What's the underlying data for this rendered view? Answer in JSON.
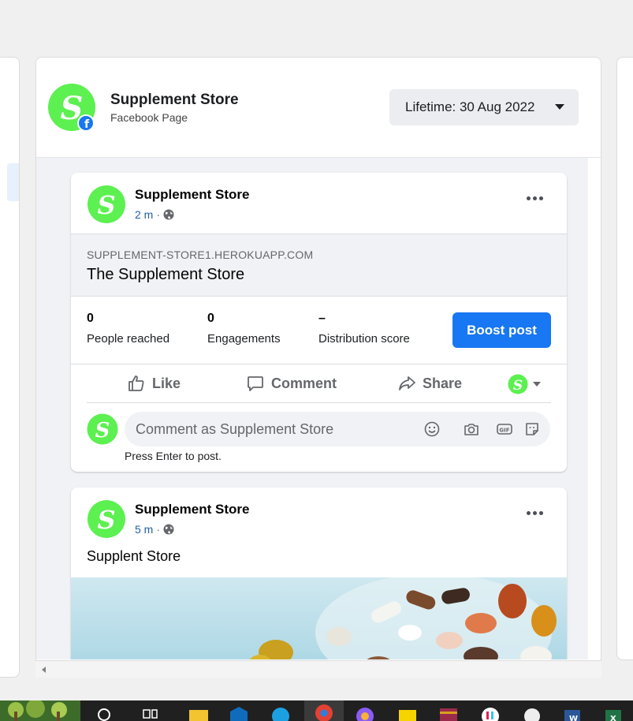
{
  "page": {
    "name": "Supplement Store",
    "type_label": "Facebook Page"
  },
  "date_filter": {
    "label": "Lifetime: 30 Aug 2022"
  },
  "posts": [
    {
      "author": "Supplement Store",
      "time": "2 m",
      "link": {
        "domain": "SUPPLEMENT-STORE1.HEROKUAPP.COM",
        "title": "The Supplement Store"
      },
      "stats": [
        {
          "value": "0",
          "label": "People reached"
        },
        {
          "value": "0",
          "label": "Engagements"
        },
        {
          "value": "–",
          "label": "Distribution score"
        }
      ],
      "boost_label": "Boost post",
      "actions": {
        "like": "Like",
        "comment": "Comment",
        "share": "Share"
      },
      "comment_placeholder": "Comment as Supplement Store",
      "comment_hint": "Press Enter to post."
    },
    {
      "author": "Supplement Store",
      "time": "5 m",
      "text": "Supplent Store"
    }
  ],
  "colors": {
    "brand_green": "#5cf050",
    "facebook_blue": "#1877f2",
    "meta_blue": "#1f5fa8"
  },
  "icons": [
    "facebook-badge-icon",
    "globe-icon",
    "more-options-icon",
    "like-icon",
    "comment-icon",
    "share-icon",
    "emoji-icon",
    "camera-icon",
    "gif-icon",
    "sticker-icon"
  ]
}
